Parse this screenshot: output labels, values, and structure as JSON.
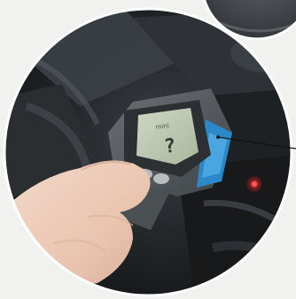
{
  "photo": {
    "subject": "handheld-infrared-thermometer",
    "lcd": {
      "line_top": "mini",
      "reading": "?"
    }
  }
}
